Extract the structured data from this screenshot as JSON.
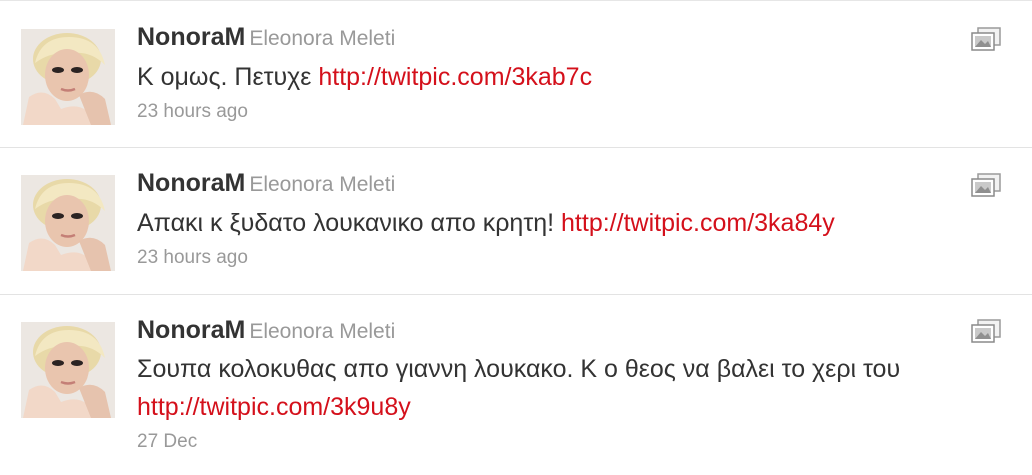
{
  "tweets": [
    {
      "screen_name": "NonoraM",
      "full_name": "Eleonora Meleti",
      "text": "Κ ομως. Πετυχε",
      "link": "http://twitpic.com/3kab7c",
      "time": "23 hours ago"
    },
    {
      "screen_name": "NonoraM",
      "full_name": "Eleonora Meleti",
      "text": "Απακι κ ξυδατο λουκανικο απο κρητη!",
      "link": "http://twitpic.com/3ka84y",
      "time": "23 hours ago"
    },
    {
      "screen_name": "NonoraM",
      "full_name": "Eleonora Meleti",
      "text": "Σουπα κολοκυθας απο γιαννη λουκακο. Κ ο θεος να βαλει το χερι του",
      "link": "http://twitpic.com/3k9u8y",
      "time": "27 Dec"
    }
  ],
  "colors": {
    "link": "#d4101b",
    "screen_name": "#333333",
    "meta": "#999999",
    "divider": "#e3e3e3"
  },
  "icons": {
    "media": "photo-gallery-icon"
  }
}
